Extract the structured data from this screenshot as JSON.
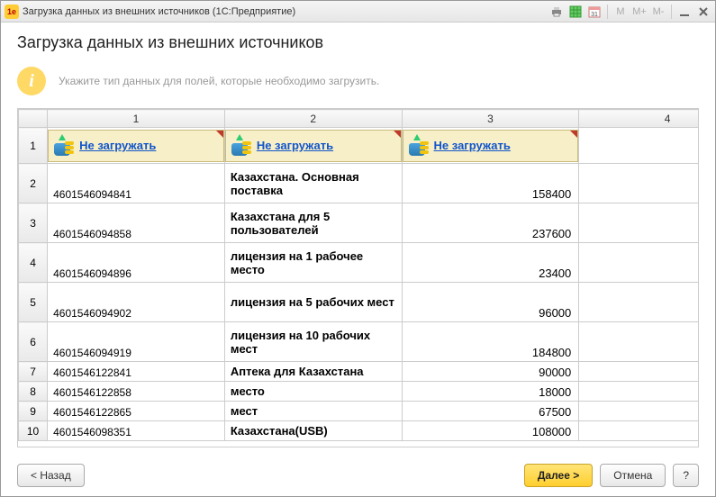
{
  "titlebar": {
    "title": "Загрузка данных из внешних источников  (1С:Предприятие)",
    "logo_text": "1e"
  },
  "page": {
    "heading": "Загрузка данных из внешних источников",
    "info": "Укажите тип данных для полей, которые необходимо загрузить."
  },
  "columns": [
    "1",
    "2",
    "3",
    "4"
  ],
  "header_link": "Не загружать",
  "rows": [
    {
      "n": "1",
      "type": "header"
    },
    {
      "n": "2",
      "a": "4601546094841",
      "b": "Казахстана. Основная поставка",
      "c": "158400",
      "tall": true
    },
    {
      "n": "3",
      "a": "4601546094858",
      "b": "Казахстана для 5 пользователей",
      "c": "237600",
      "tall": true
    },
    {
      "n": "4",
      "a": "4601546094896",
      "b": "лицензия на 1 рабочее место",
      "c": "23400",
      "tall": true
    },
    {
      "n": "5",
      "a": "4601546094902",
      "b": "лицензия на 5 рабочих мест",
      "c": "96000",
      "tall": true
    },
    {
      "n": "6",
      "a": "4601546094919",
      "b": "лицензия на 10 рабочих мест",
      "c": "184800",
      "tall": true
    },
    {
      "n": "7",
      "a": "4601546122841",
      "b": "Аптека для Казахстана",
      "c": "90000"
    },
    {
      "n": "8",
      "a": "4601546122858",
      "b": "место",
      "c": "18000"
    },
    {
      "n": "9",
      "a": "4601546122865",
      "b": "мест",
      "c": "67500"
    },
    {
      "n": "10",
      "a": "4601546098351",
      "b": "Казахстана(USB)",
      "c": "108000"
    }
  ],
  "footer": {
    "back": "< Назад",
    "next": "Далее >",
    "cancel": "Отмена",
    "help": "?"
  }
}
